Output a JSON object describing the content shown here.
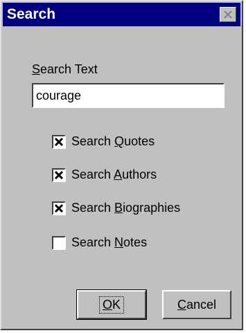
{
  "window": {
    "title": "Search"
  },
  "form": {
    "search_label_accel": "S",
    "search_label_rest": "earch Text",
    "search_value": "courage"
  },
  "options": [
    {
      "prefix": "Search ",
      "accel": "Q",
      "rest": "uotes",
      "checked": true
    },
    {
      "prefix": "Search ",
      "accel": "A",
      "rest": "uthors",
      "checked": true
    },
    {
      "prefix": "Search ",
      "accel": "B",
      "rest": "iographies",
      "checked": true
    },
    {
      "prefix": "Search ",
      "accel": "N",
      "rest": "otes",
      "checked": false
    }
  ],
  "buttons": {
    "ok_accel": "O",
    "ok_rest": "K",
    "cancel_accel": "C",
    "cancel_rest": "ancel"
  },
  "icons": {
    "close": "close-icon",
    "check": "check-mark-icon"
  },
  "colors": {
    "titlebar": "#000080",
    "face": "#c0c0c0"
  }
}
